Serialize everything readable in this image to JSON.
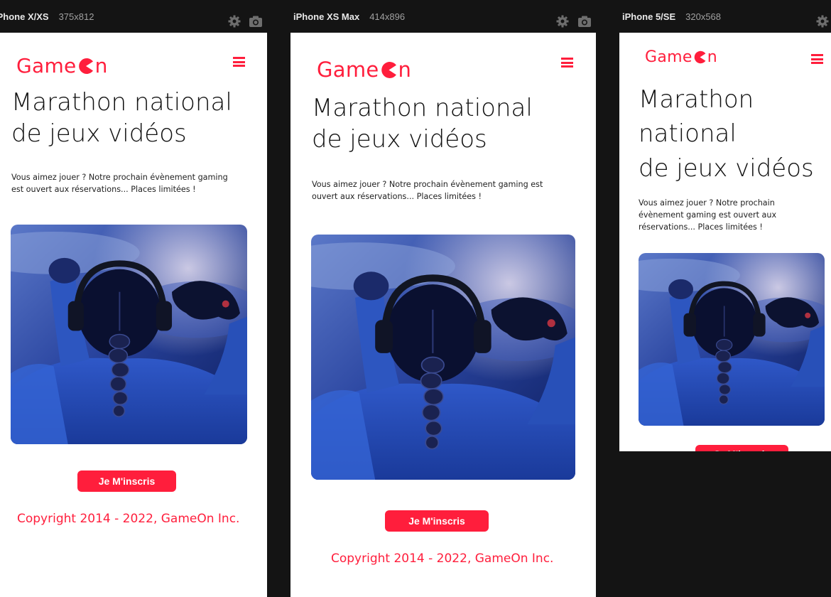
{
  "devices": [
    {
      "name": "iPhone X/XS",
      "size": "375x812"
    },
    {
      "name": "iPhone XS Max",
      "size": "414x896"
    },
    {
      "name": "iPhone 5/SE",
      "size": "320x568"
    }
  ],
  "toolbar_icons": [
    "gear-icon",
    "camera-icon"
  ],
  "page": {
    "logo_text_before": "Game",
    "logo_text_after": "n",
    "menu_icon": "hamburger-menu-icon",
    "title_line1": "Marathon national",
    "title_line2": "de jeux vidéos",
    "title_part_marathon": "Marathon",
    "title_part_national": "national",
    "intro": "Vous aimez jouer ? Notre prochain évènement gaming est ouvert aux réservations... Places limitées !",
    "cta_label": "Je M'inscris",
    "footer": "Copyright 2014 - 2022, GameOn Inc."
  },
  "colors": {
    "brand_red": "#ff1e3c",
    "background": "#141414",
    "screen": "#ffffff"
  }
}
